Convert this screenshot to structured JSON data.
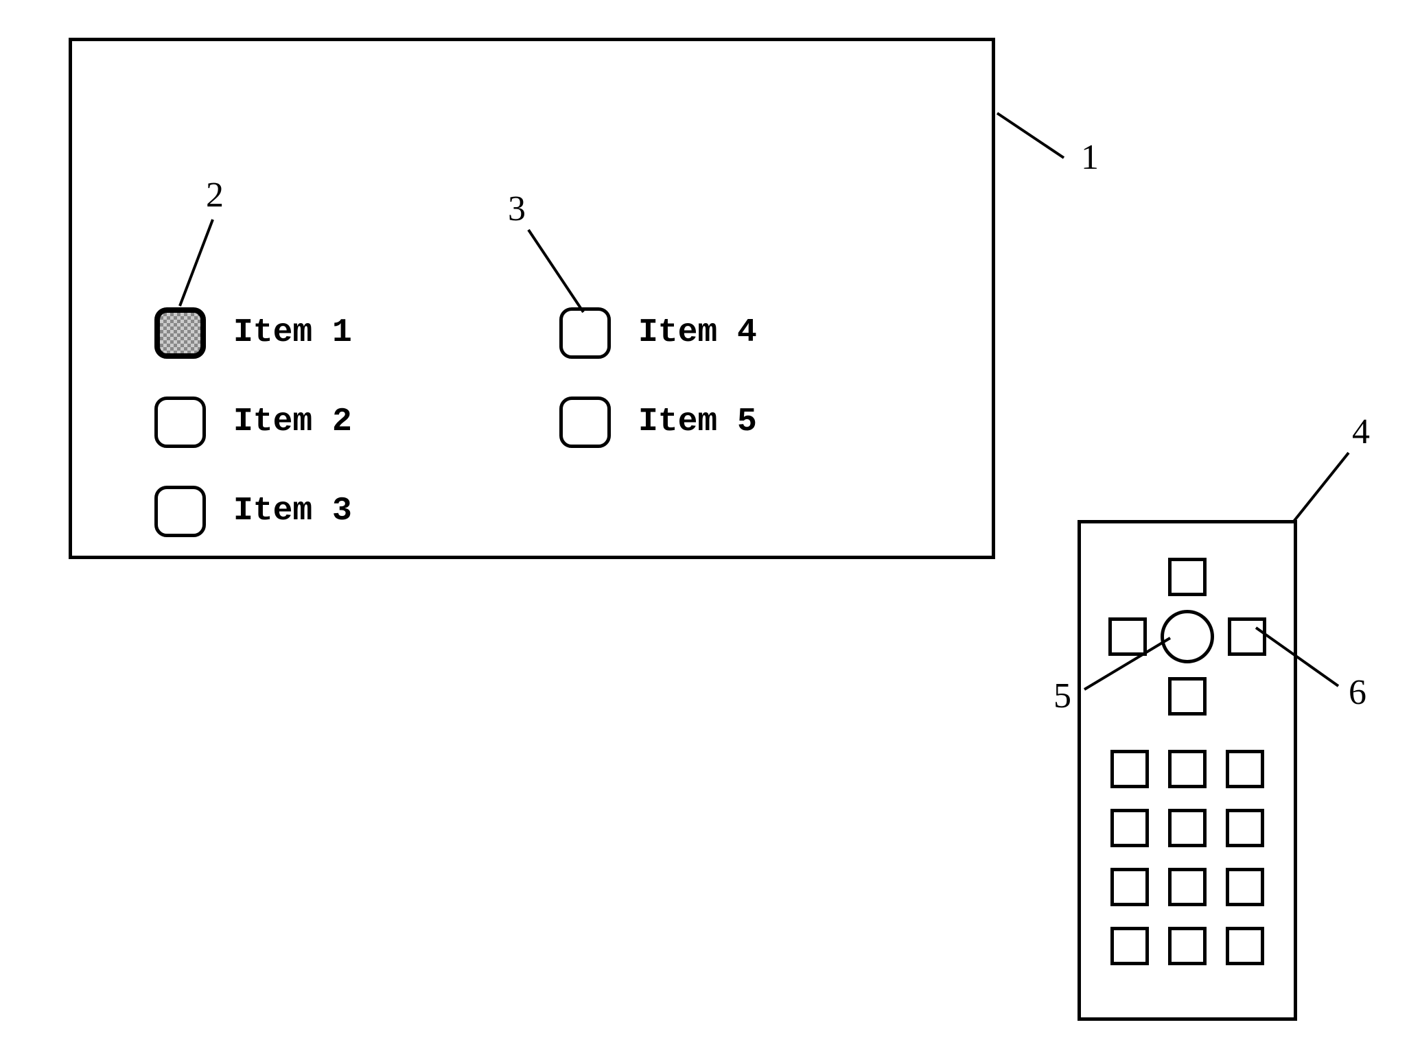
{
  "screen": {
    "items_left": [
      {
        "label": "Item 1",
        "selected": true
      },
      {
        "label": "Item 2",
        "selected": false
      },
      {
        "label": "Item 3",
        "selected": false
      }
    ],
    "items_right": [
      {
        "label": "Item 4",
        "selected": false
      },
      {
        "label": "Item 5",
        "selected": false
      }
    ]
  },
  "callouts": {
    "screen": "1",
    "selected_box": "2",
    "item_box": "3",
    "remote": "4",
    "center_button": "5",
    "dpad_right": "6"
  }
}
